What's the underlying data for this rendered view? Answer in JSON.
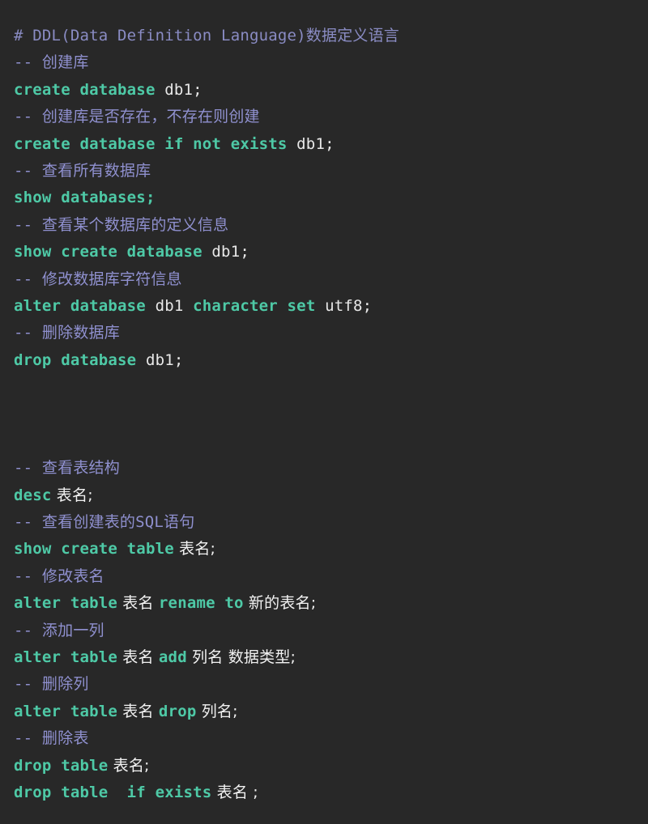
{
  "editor": {
    "background_color": "#282828",
    "heading_color": "#8a8cc4",
    "comment_color": "#8f90cf",
    "keyword_color": "#4ec9a6",
    "plain_text_color": "#e8e8e8",
    "cjk_text_color": "#f2f2f2",
    "language": "sql",
    "font_size_px": 19,
    "line_height_px": 33.4
  },
  "document": {
    "title": "# DDL(Data Definition Language)数据定义语言",
    "lines": [
      {
        "index": 1,
        "type": "heading",
        "text": "# DDL(Data Definition Language)数据定义语言",
        "tokens": [
          {
            "kind": "heading",
            "text": "# DDL(Data Definition Language)数据定义语言"
          }
        ]
      },
      {
        "index": 2,
        "type": "comment",
        "text": "-- 创建库",
        "tokens": [
          {
            "kind": "comment",
            "text": "-- 创建库"
          }
        ]
      },
      {
        "index": 3,
        "type": "code",
        "text": "create database db1;",
        "tokens": [
          {
            "kind": "keyword",
            "text": "create database"
          },
          {
            "kind": "plain",
            "text": " db1;"
          }
        ]
      },
      {
        "index": 4,
        "type": "comment",
        "text": "-- 创建库是否存在，不存在则创建",
        "tokens": [
          {
            "kind": "comment",
            "text": "-- 创建库是否存在，不存在则创建"
          }
        ]
      },
      {
        "index": 5,
        "type": "code",
        "text": "create database if not exists db1;",
        "tokens": [
          {
            "kind": "keyword",
            "text": "create database if not exists"
          },
          {
            "kind": "plain",
            "text": " db1;"
          }
        ]
      },
      {
        "index": 6,
        "type": "comment",
        "text": "-- 查看所有数据库",
        "tokens": [
          {
            "kind": "comment",
            "text": "-- 查看所有数据库"
          }
        ]
      },
      {
        "index": 7,
        "type": "code",
        "text": "show databases;",
        "tokens": [
          {
            "kind": "keyword",
            "text": "show databases;"
          }
        ]
      },
      {
        "index": 8,
        "type": "comment",
        "text": "-- 查看某个数据库的定义信息",
        "tokens": [
          {
            "kind": "comment",
            "text": "-- 查看某个数据库的定义信息"
          }
        ]
      },
      {
        "index": 9,
        "type": "code",
        "text": "show create database db1;",
        "tokens": [
          {
            "kind": "keyword",
            "text": "show create database"
          },
          {
            "kind": "plain",
            "text": " db1;"
          }
        ]
      },
      {
        "index": 10,
        "type": "comment",
        "text": "-- 修改数据库字符信息",
        "tokens": [
          {
            "kind": "comment",
            "text": "-- 修改数据库字符信息"
          }
        ]
      },
      {
        "index": 11,
        "type": "code",
        "text": "alter database db1 character set utf8;",
        "tokens": [
          {
            "kind": "keyword",
            "text": "alter database"
          },
          {
            "kind": "plain",
            "text": " db1 "
          },
          {
            "kind": "keyword",
            "text": "character set"
          },
          {
            "kind": "plain",
            "text": " utf8;"
          }
        ]
      },
      {
        "index": 12,
        "type": "comment",
        "text": "-- 删除数据库",
        "tokens": [
          {
            "kind": "comment",
            "text": "-- 删除数据库"
          }
        ]
      },
      {
        "index": 13,
        "type": "code",
        "text": "drop database db1;",
        "tokens": [
          {
            "kind": "keyword",
            "text": "drop database"
          },
          {
            "kind": "plain",
            "text": " db1;"
          }
        ]
      },
      {
        "index": 14,
        "type": "blank",
        "text": "",
        "tokens": []
      },
      {
        "index": 15,
        "type": "blank",
        "text": "",
        "tokens": []
      },
      {
        "index": 16,
        "type": "blank",
        "text": "",
        "tokens": []
      },
      {
        "index": 17,
        "type": "comment",
        "text": "-- 查看表结构",
        "tokens": [
          {
            "kind": "comment",
            "text": "-- 查看表结构"
          }
        ]
      },
      {
        "index": 18,
        "type": "code",
        "text": "desc 表名;",
        "tokens": [
          {
            "kind": "keyword",
            "text": "desc"
          },
          {
            "kind": "cjk",
            "text": " 表名;"
          }
        ]
      },
      {
        "index": 19,
        "type": "comment",
        "text": "-- 查看创建表的SQL语句",
        "tokens": [
          {
            "kind": "comment",
            "text": "-- 查看创建表的SQL语句"
          }
        ]
      },
      {
        "index": 20,
        "type": "code",
        "text": "show create table 表名;",
        "tokens": [
          {
            "kind": "keyword",
            "text": "show create table"
          },
          {
            "kind": "cjk",
            "text": " 表名;"
          }
        ]
      },
      {
        "index": 21,
        "type": "comment",
        "text": "-- 修改表名",
        "tokens": [
          {
            "kind": "comment",
            "text": "-- 修改表名"
          }
        ]
      },
      {
        "index": 22,
        "type": "code",
        "text": "alter table 表名 rename to 新的表名;",
        "tokens": [
          {
            "kind": "keyword",
            "text": "alter table"
          },
          {
            "kind": "cjk",
            "text": " 表名 "
          },
          {
            "kind": "keyword",
            "text": "rename to"
          },
          {
            "kind": "cjk",
            "text": " 新的表名;"
          }
        ]
      },
      {
        "index": 23,
        "type": "comment",
        "text": "-- 添加一列",
        "tokens": [
          {
            "kind": "comment",
            "text": "-- 添加一列"
          }
        ]
      },
      {
        "index": 24,
        "type": "code",
        "text": "alter table 表名 add 列名 数据类型;",
        "tokens": [
          {
            "kind": "keyword",
            "text": "alter table"
          },
          {
            "kind": "cjk",
            "text": " 表名 "
          },
          {
            "kind": "keyword",
            "text": "add"
          },
          {
            "kind": "cjk",
            "text": " 列名 数据类型;"
          }
        ]
      },
      {
        "index": 25,
        "type": "comment",
        "text": "-- 删除列",
        "tokens": [
          {
            "kind": "comment",
            "text": "-- 删除列"
          }
        ]
      },
      {
        "index": 26,
        "type": "code",
        "text": "alter table 表名 drop 列名;",
        "tokens": [
          {
            "kind": "keyword",
            "text": "alter table"
          },
          {
            "kind": "cjk",
            "text": " 表名 "
          },
          {
            "kind": "keyword",
            "text": "drop"
          },
          {
            "kind": "cjk",
            "text": " 列名;"
          }
        ]
      },
      {
        "index": 27,
        "type": "comment",
        "text": "-- 删除表",
        "tokens": [
          {
            "kind": "comment",
            "text": "-- 删除表"
          }
        ]
      },
      {
        "index": 28,
        "type": "code",
        "text": "drop table 表名;",
        "tokens": [
          {
            "kind": "keyword",
            "text": "drop table"
          },
          {
            "kind": "cjk",
            "text": " 表名;"
          }
        ]
      },
      {
        "index": 29,
        "type": "code",
        "text": "drop table  if exists 表名 ;",
        "tokens": [
          {
            "kind": "keyword",
            "text": "drop table  if exists"
          },
          {
            "kind": "cjk",
            "text": " 表名 ;"
          }
        ]
      }
    ]
  }
}
